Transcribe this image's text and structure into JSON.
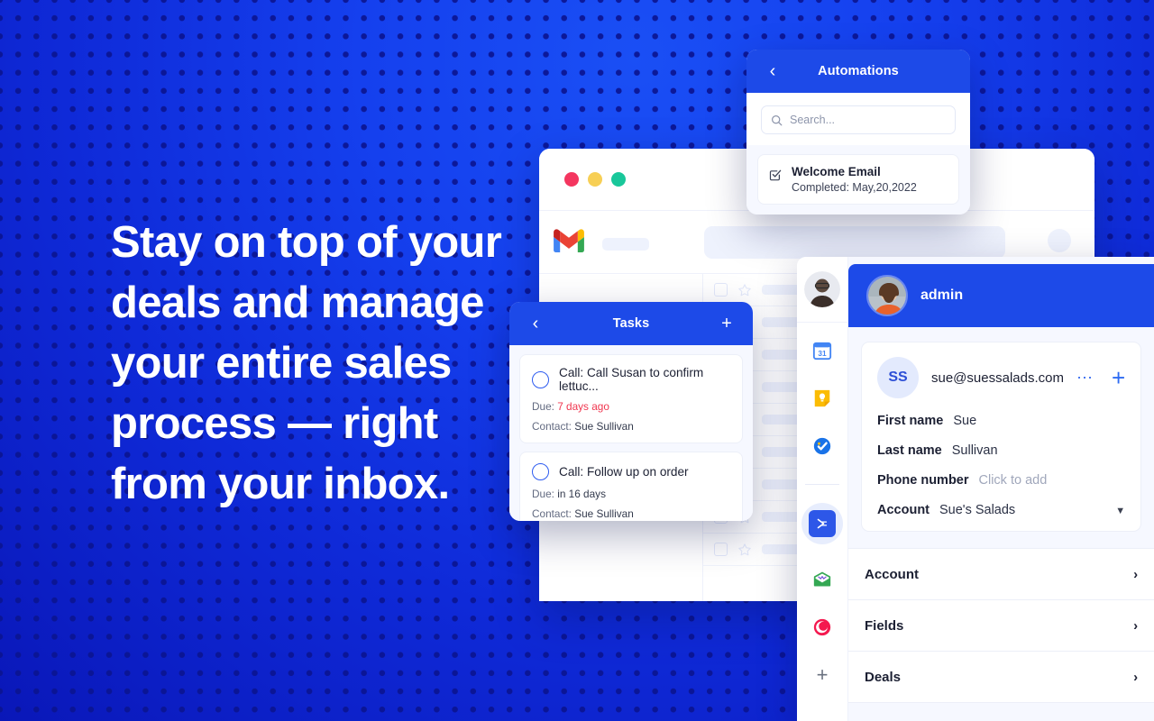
{
  "hero": {
    "headline": "Stay on top of your deals and manage your entire sales process — right from your inbox.",
    "bg_color": "#1540ee",
    "dot_color": "#0b1491"
  },
  "browser": {
    "traffic_lights": [
      "close-red",
      "minimize-yellow",
      "zoom-green"
    ],
    "app_logo": "gmail-logo",
    "search_placeholder": "",
    "mail_rows": 9
  },
  "automations": {
    "back_icon": "chevron-left-icon",
    "title": "Automations",
    "search": {
      "icon": "search-icon",
      "placeholder": "Search...",
      "value": ""
    },
    "items": [
      {
        "icon": "task-complete-icon",
        "title": "Welcome Email",
        "status_label": "Completed:",
        "status_date": "May,20,2022"
      }
    ]
  },
  "tasks": {
    "back_icon": "chevron-left-icon",
    "title": "Tasks",
    "add_icon": "plus-icon",
    "items": [
      {
        "name": "Call: Call Susan to confirm lettuc...",
        "due_label": "Due:",
        "due_value": "7 days ago",
        "due_overdue": true,
        "contact_label": "Contact:",
        "contact_value": "Sue Sullivan"
      },
      {
        "name": "Call: Follow up on order",
        "due_label": "Due:",
        "due_value": "in 16 days",
        "due_overdue": false,
        "contact_label": "Contact:",
        "contact_value": "Sue Sullivan"
      }
    ],
    "overdue_color": "#f0364f"
  },
  "right_panel": {
    "rail": {
      "avatar": "user-avatar",
      "icons": [
        "google-calendar-icon",
        "google-keep-icon",
        "google-tasks-icon"
      ],
      "active_icon": "streak-app-icon",
      "extra_icons": [
        "mailtrack-envelope-icon",
        "boomerang-icon"
      ],
      "add_icon": "plus-icon"
    },
    "header": {
      "avatar": "admin-avatar",
      "name": "admin"
    },
    "contact": {
      "initials": "SS",
      "email": "sue@suessalads.com",
      "more_icon": "ellipsis-icon",
      "add_icon": "plus-icon",
      "fields": [
        {
          "key": "First name",
          "value": "Sue",
          "placeholder": false
        },
        {
          "key": "Last name",
          "value": "Sullivan",
          "placeholder": false
        },
        {
          "key": "Phone number",
          "value": "Click to add",
          "placeholder": true
        },
        {
          "key": "Account",
          "value": "Sue's Salads",
          "placeholder": false,
          "caret": "caret-down-icon"
        }
      ]
    },
    "sections": [
      {
        "label": "Account",
        "chevron": "chevron-right-icon"
      },
      {
        "label": "Fields",
        "chevron": "chevron-right-icon"
      },
      {
        "label": "Deals",
        "chevron": "chevron-right-icon"
      }
    ]
  },
  "colors": {
    "brand_blue": "#1d4ae8",
    "panel_bg": "#f6f8ff",
    "skeleton": "#eef2fd"
  }
}
